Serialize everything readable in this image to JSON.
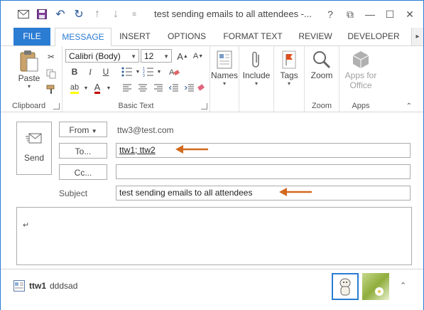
{
  "window": {
    "title": "test sending emails to all attendees -...",
    "help": "?",
    "restore": "⧉",
    "minimize": "—",
    "maximize": "☐",
    "close": "✕"
  },
  "tabs": [
    {
      "label": "FILE"
    },
    {
      "label": "MESSAGE"
    },
    {
      "label": "INSERT"
    },
    {
      "label": "OPTIONS"
    },
    {
      "label": "FORMAT TEXT"
    },
    {
      "label": "REVIEW"
    },
    {
      "label": "DEVELOPER"
    }
  ],
  "ribbon": {
    "clipboard": {
      "label": "Clipboard",
      "paste": "Paste"
    },
    "basic_text": {
      "label": "Basic Text",
      "font": "Calibri (Body)",
      "size": "12",
      "bold": "B",
      "italic": "I",
      "underline": "U",
      "font_color_letter": "A",
      "highlight_letters": "ab"
    },
    "names": {
      "label": "Names"
    },
    "include": {
      "label": "Include"
    },
    "tags": {
      "label": "Tags"
    },
    "zoom": {
      "label": "Zoom",
      "group": "Zoom"
    },
    "apps": {
      "label": "Apps for Office",
      "group": "Apps"
    }
  },
  "compose": {
    "send": "Send",
    "from_button": "From",
    "from_value": "ttw3@test.com",
    "to_button": "To...",
    "to_value": "ttw1; ttw2",
    "cc_button": "Cc...",
    "cc_value": "",
    "subject_label": "Subject",
    "subject_value": "test sending emails to all attendees"
  },
  "people_pane": {
    "name": "ttw1",
    "status": "dddsad"
  },
  "colors": {
    "accent": "#2b7cd3",
    "annotation_arrow": "#d2691e"
  }
}
